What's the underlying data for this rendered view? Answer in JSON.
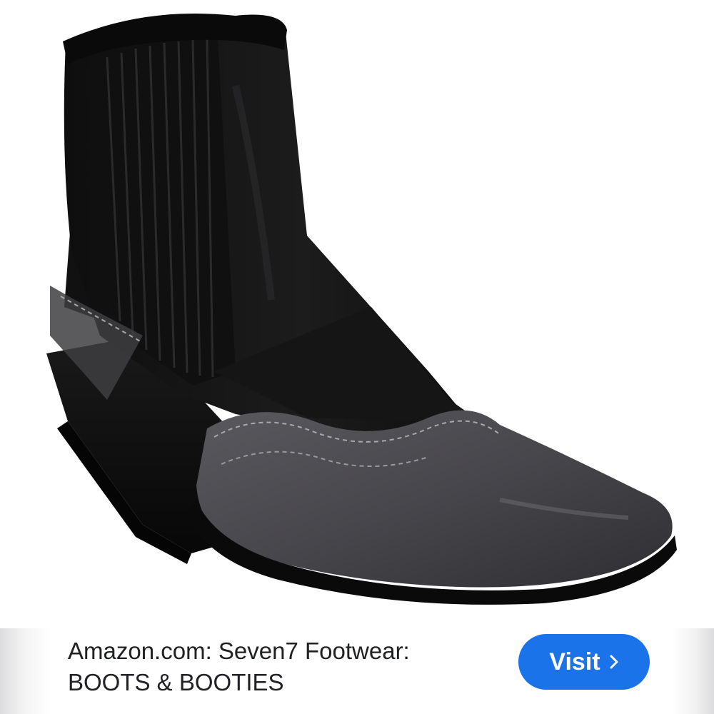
{
  "result": {
    "source": "Amazon.com:",
    "title_line1": "Amazon.com: Seven7 Footwear:",
    "title_line2": "BOOTS & BOOTIES",
    "image_subject": "black leather chelsea ankle boot with grey pointed toe and block heel"
  },
  "visit_button": {
    "label": "Visit",
    "icon": "chevron-right-icon",
    "color": "#1a73e8"
  },
  "colors": {
    "leather_black": "#161616",
    "toe_grey": "#4b4a4f",
    "stitch": "#a8a8ac",
    "caption_text": "#202124"
  }
}
